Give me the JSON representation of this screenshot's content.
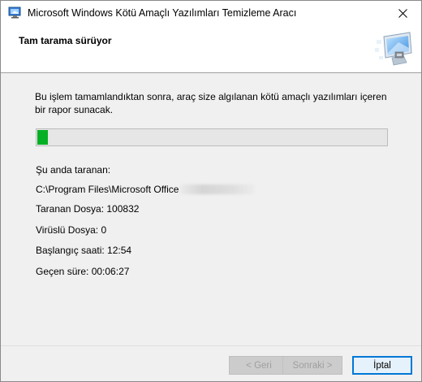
{
  "window": {
    "title": "Microsoft Windows Kötü Amaçlı Yazılımları Temizleme Aracı"
  },
  "header": {
    "title": "Tam tarama sürüyor"
  },
  "description": "Bu işlem tamamlandıktan sonra, araç size algılanan kötü amaçlı yazılımları içeren bir rapor sunacak.",
  "progress": {
    "fraction": 0.03,
    "color": "#06b025"
  },
  "scan": {
    "current_label": "Şu anda taranan:",
    "current_path": "C:\\Program Files\\Microsoft Office",
    "scanned_files": "Taranan Dosya: 100832",
    "infected_files": "Virüslü Dosya: 0",
    "start_time": "Başlangıç saati: 12:54",
    "elapsed_time": "Geçen süre: 00:06:27"
  },
  "buttons": {
    "back": "< Geri",
    "next": "Sonraki >",
    "cancel": "İptal"
  },
  "colors": {
    "accent": "#0078d7"
  }
}
